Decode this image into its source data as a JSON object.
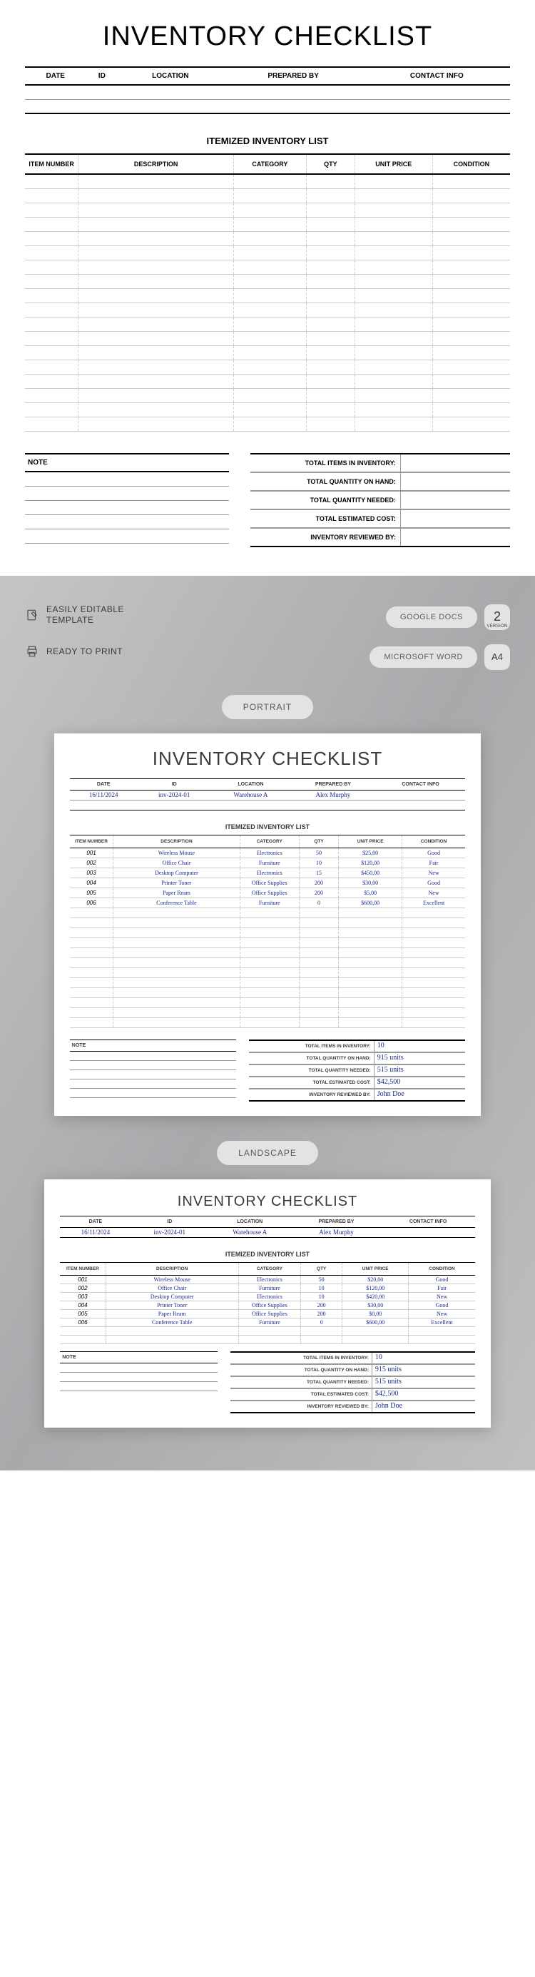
{
  "header": {
    "title": "INVENTORY CHECKLIST",
    "cols": [
      "DATE",
      "ID",
      "LOCATION",
      "PREPARED BY",
      "CONTACT INFO"
    ]
  },
  "subheading": "ITEMIZED INVENTORY LIST",
  "item_cols": [
    "ITEM NUMBER",
    "DESCRIPTION",
    "CATEGORY",
    "QTY",
    "UNIT PRICE",
    "CONDITION"
  ],
  "note_label": "NOTE",
  "totals": {
    "rows": [
      "TOTAL ITEMS IN INVENTORY:",
      "TOTAL QUANTITY ON HAND:",
      "TOTAL QUANTITY NEEDED:",
      "TOTAL ESTIMATED COST:",
      "INVENTORY REVIEWED BY:"
    ]
  },
  "features": {
    "editable": "EASILY EDITABLE\nTEMPLATE",
    "print": "READY TO PRINT",
    "gdocs": "GOOGLE DOCS",
    "word": "MICROSOFT WORD",
    "version_num": "2",
    "version_sub": "VERSION",
    "a4": "A4",
    "portrait_label": "PORTRAIT",
    "landscape_label": "LANDSCAPE"
  },
  "sample": {
    "meta": {
      "date": "16/11/2024",
      "id": "inv-2024-01",
      "location": "Warehouse A",
      "prepared_by": "Alex Murphy",
      "contact": ""
    },
    "items": [
      {
        "num": "001",
        "desc": "Wireless Mouse",
        "cat": "Electronics",
        "qty": "50",
        "price": "$25,00",
        "cond": "Good"
      },
      {
        "num": "002",
        "desc": "Office Chair",
        "cat": "Furniture",
        "qty": "10",
        "price": "$120,00",
        "cond": "Fair"
      },
      {
        "num": "003",
        "desc": "Desktop Computer",
        "cat": "Electronics",
        "qty": "15",
        "price": "$450,00",
        "cond": "New"
      },
      {
        "num": "004",
        "desc": "Printer Toner",
        "cat": "Office Supplies",
        "qty": "200",
        "price": "$30,00",
        "cond": "Good"
      },
      {
        "num": "005",
        "desc": "Paper Ream",
        "cat": "Office Supplies",
        "qty": "200",
        "price": "$5,00",
        "cond": "New"
      },
      {
        "num": "006",
        "desc": "Conference Table",
        "cat": "Furniture",
        "qty": "0",
        "price": "$600,00",
        "cond": "Excellent"
      }
    ],
    "totals_vals": [
      "10",
      "915 units",
      "515 units",
      "$42,500",
      "John Doe"
    ]
  },
  "landscape_sample": {
    "items": [
      {
        "num": "001",
        "desc": "Wireless Mouse",
        "cat": "Electronics",
        "qty": "50",
        "price": "$20,00",
        "cond": "Good"
      },
      {
        "num": "002",
        "desc": "Office Chair",
        "cat": "Furniture",
        "qty": "10",
        "price": "$120,00",
        "cond": "Fair"
      },
      {
        "num": "003",
        "desc": "Desktop Computer",
        "cat": "Electronics",
        "qty": "10",
        "price": "$420,00",
        "cond": "New"
      },
      {
        "num": "004",
        "desc": "Printer Toner",
        "cat": "Office Supplies",
        "qty": "200",
        "price": "$30,00",
        "cond": "Good"
      },
      {
        "num": "005",
        "desc": "Paper Ream",
        "cat": "Office Supplies",
        "qty": "200",
        "price": "$0,00",
        "cond": "New"
      },
      {
        "num": "006",
        "desc": "Conference Table",
        "cat": "Furniture",
        "qty": "0",
        "price": "$600,00",
        "cond": "Excellent"
      }
    ]
  }
}
